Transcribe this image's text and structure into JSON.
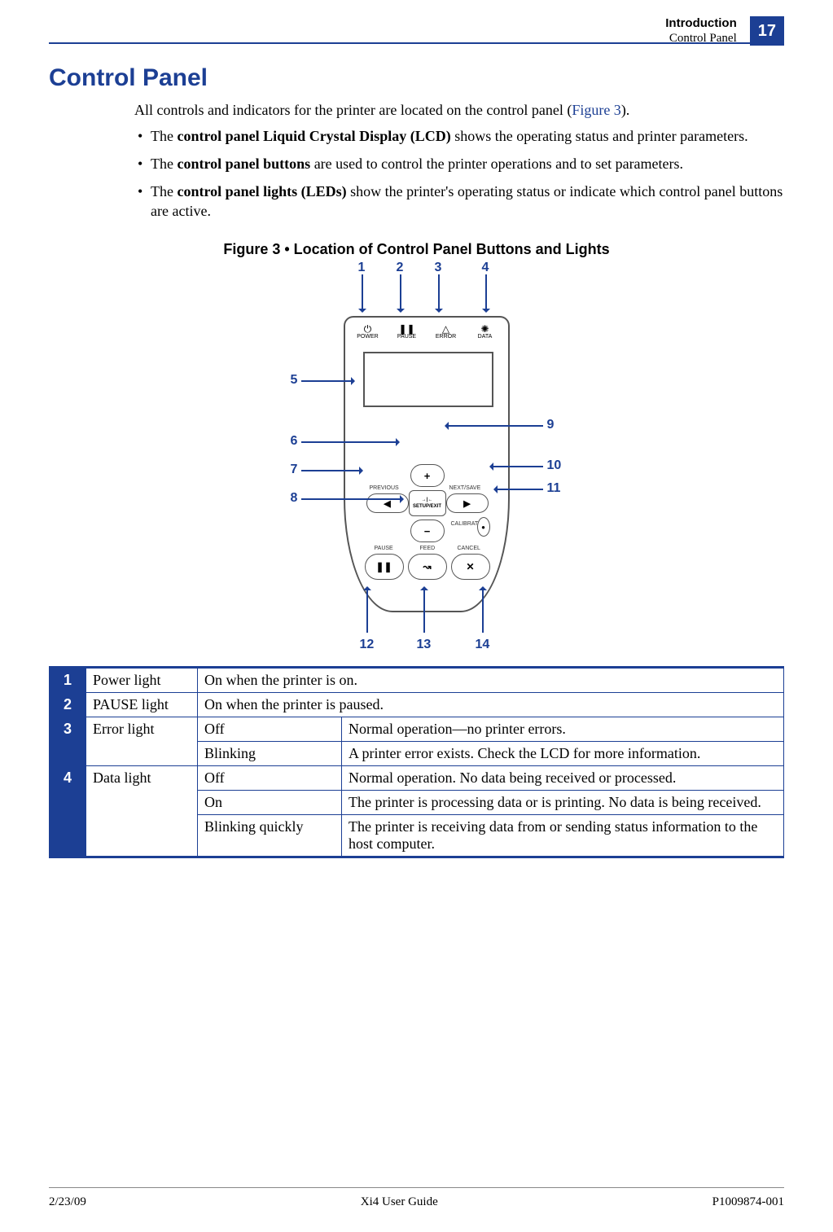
{
  "header": {
    "chapter": "Introduction",
    "section": "Control Panel",
    "page": "17"
  },
  "title": "Control Panel",
  "intro": {
    "lead_before_link": "All controls and indicators for the printer are located on the control panel (",
    "link": "Figure 3",
    "lead_after_link": ")."
  },
  "bullets": [
    {
      "prefix": "The ",
      "bold": "control panel Liquid Crystal Display (LCD)",
      "rest": " shows the operating status and printer parameters."
    },
    {
      "prefix": "The ",
      "bold": "control panel buttons",
      "rest": " are used to control the printer operations and to set parameters."
    },
    {
      "prefix": "The ",
      "bold": "control panel lights (LEDs)",
      "rest": " show the printer's operating status or indicate which control panel buttons are active."
    }
  ],
  "figure_caption": "Figure 3 • Location of Control Panel Buttons and Lights",
  "panel_leds": [
    "POWER",
    "PAUSE",
    "ERROR",
    "DATA"
  ],
  "panel_btn_labels": {
    "previous": "PREVIOUS",
    "nextsave": "NEXT/SAVE",
    "setupexit": "SETUP/EXIT",
    "calibrate": "CALIBRATE",
    "pause": "PAUSE",
    "feed": "FEED",
    "cancel": "CANCEL"
  },
  "callouts": [
    "1",
    "2",
    "3",
    "4",
    "5",
    "6",
    "7",
    "8",
    "9",
    "10",
    "11",
    "12",
    "13",
    "14"
  ],
  "legend": [
    {
      "num": "1",
      "name": "Power light",
      "desc": "On when the printer is on."
    },
    {
      "num": "2",
      "name": "PAUSE light",
      "desc": "On when the printer is paused."
    },
    {
      "num": "3",
      "name": "Error light",
      "rows": [
        {
          "state": "Off",
          "desc": "Normal operation—no printer errors."
        },
        {
          "state": "Blinking",
          "desc": "A printer error exists. Check the LCD for more information."
        }
      ]
    },
    {
      "num": "4",
      "name": "Data light",
      "rows": [
        {
          "state": "Off",
          "desc": "Normal operation. No data being received or processed."
        },
        {
          "state": "On",
          "desc": "The printer is processing data or is printing. No data is being received."
        },
        {
          "state": "Blinking quickly",
          "desc": "The printer is receiving data from or sending status information to the host computer."
        }
      ]
    }
  ],
  "footer": {
    "left": "2/23/09",
    "center": "Xi4 User Guide",
    "right": "P1009874-001"
  }
}
